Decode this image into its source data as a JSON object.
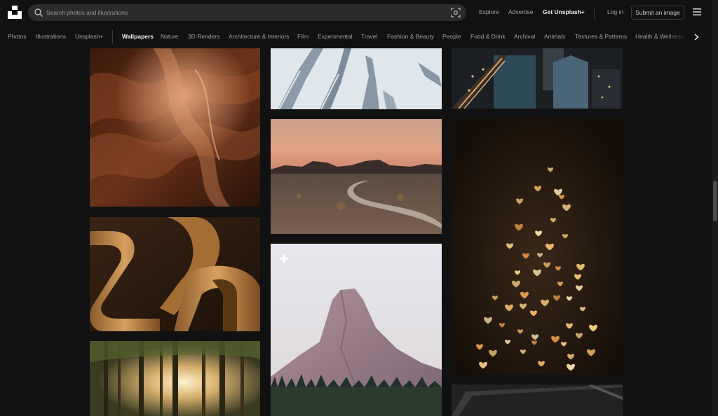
{
  "header": {
    "search_placeholder": "Search photos and illustrations",
    "links": {
      "explore": "Explore",
      "advertise": "Advertise",
      "get_plus": "Get Unsplash+",
      "login": "Log in"
    },
    "submit_label": "Submit an image",
    "icons": [
      "unsplash-logo",
      "search-icon",
      "visual-search-icon",
      "menu-icon"
    ]
  },
  "categories": {
    "items": [
      "Photos",
      "Illustrations",
      "Unsplash+",
      "Wallpapers",
      "Nature",
      "3D Renders",
      "Architecture & Interiors",
      "Film",
      "Experimental",
      "Travel",
      "Fashion & Beauty",
      "People",
      "Food & Drink",
      "Archival",
      "Animals",
      "Textures & Patterns",
      "Health & Wellness"
    ],
    "active": "Wallpapers",
    "next_icon": "chevron-right-icon"
  },
  "colors": {
    "background": "#111111",
    "search_bg": "#2b2b2b",
    "text_muted": "#a0a0a0",
    "text_active": "#f4f4f4"
  },
  "grid": {
    "images": [
      "canyon-photo",
      "golden-3d-render",
      "forest-sunlight-photo",
      "snowy-ridges-aerial-photo",
      "desert-road-photo",
      "mountain-peak-photo",
      "city-aerial-night-photo",
      "heart-bokeh-tree-photo",
      "dark-abstract-photo"
    ]
  }
}
